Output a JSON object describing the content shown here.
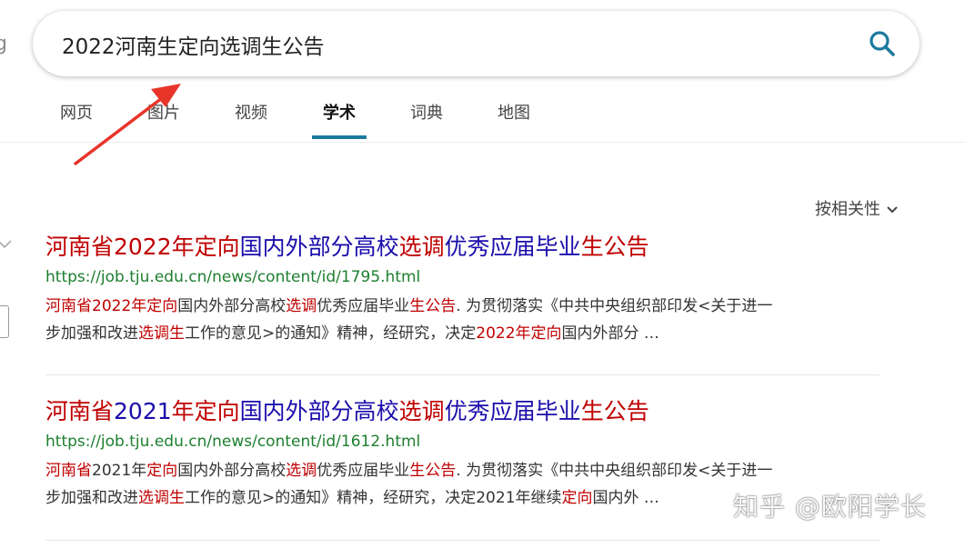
{
  "logo_fragment": "g",
  "search": {
    "value": "2022河南生定向选调生公告",
    "icon": "search-icon"
  },
  "tabs": [
    {
      "label": "网页"
    },
    {
      "label": "图片"
    },
    {
      "label": "视频"
    },
    {
      "label": "学术",
      "active": true
    },
    {
      "label": "词典"
    },
    {
      "label": "地图"
    }
  ],
  "sort": {
    "label": "按相关性",
    "icon": "chevron-down-icon"
  },
  "colors": {
    "title": "#1a0dab",
    "highlight": "#c00000",
    "url": "#1d7f2f",
    "tab_underline": "#1c7a9e",
    "arrow": "#e8352a"
  },
  "results": [
    {
      "title": [
        {
          "t": "河南省2022年定向",
          "hl": true
        },
        {
          "t": "国内外部分高校",
          "hl": false
        },
        {
          "t": "选调",
          "hl": true
        },
        {
          "t": "优秀应届毕业",
          "hl": false
        },
        {
          "t": "生公告",
          "hl": true
        }
      ],
      "url": "https://job.tju.edu.cn/news/content/id/1795.html",
      "snippet_line1": [
        {
          "t": "河南省2022年定向",
          "hl": true
        },
        {
          "t": "国内外部分高校",
          "hl": false
        },
        {
          "t": "选调",
          "hl": true
        },
        {
          "t": "优秀应届毕业",
          "hl": false
        },
        {
          "t": "生公告",
          "hl": true
        },
        {
          "t": ". 为贯彻落实《中共中央组织部印发<关于进一",
          "hl": false
        }
      ],
      "snippet_line2": [
        {
          "t": "步加强和改进",
          "hl": false
        },
        {
          "t": "选调生",
          "hl": true
        },
        {
          "t": "工作的意见>的通知》精神，经研究，决定",
          "hl": false
        },
        {
          "t": "2022年定向",
          "hl": true
        },
        {
          "t": "国内外部分 …",
          "hl": false
        }
      ]
    },
    {
      "title": [
        {
          "t": "河南省",
          "hl": true
        },
        {
          "t": "2021",
          "hl": false
        },
        {
          "t": "年定向",
          "hl": true
        },
        {
          "t": "国内外部分高校",
          "hl": false
        },
        {
          "t": "选调",
          "hl": true
        },
        {
          "t": "优秀应届毕业",
          "hl": false
        },
        {
          "t": "生公告",
          "hl": true
        }
      ],
      "url": "https://job.tju.edu.cn/news/content/id/1612.html",
      "snippet_line1": [
        {
          "t": "河南省",
          "hl": true
        },
        {
          "t": "2021年",
          "hl": false
        },
        {
          "t": "定向",
          "hl": true
        },
        {
          "t": "国内外部分高校",
          "hl": false
        },
        {
          "t": "选调",
          "hl": true
        },
        {
          "t": "优秀应届毕业",
          "hl": false
        },
        {
          "t": "生公告",
          "hl": true
        },
        {
          "t": ". 为贯彻落实《中共中央组织部印发<关于进一",
          "hl": false
        }
      ],
      "snippet_line2": [
        {
          "t": "步加强和改进",
          "hl": false
        },
        {
          "t": "选调生",
          "hl": true
        },
        {
          "t": "工作的意见>的通知》精神，经研究，决定2021年继续",
          "hl": false
        },
        {
          "t": "定向",
          "hl": true
        },
        {
          "t": "国内外 …",
          "hl": false
        }
      ]
    }
  ],
  "watermark": "知乎 @欧阳学长"
}
